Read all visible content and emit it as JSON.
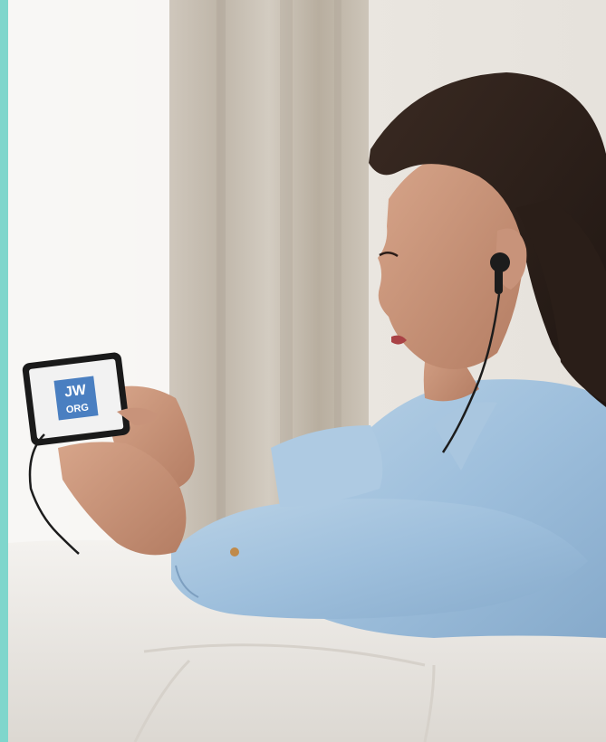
{
  "image": {
    "accent_color": "#7fd6cc",
    "subject": "woman-with-earphones-watching-phone",
    "device_screen": {
      "logo_line1": "JW",
      "logo_line2": "ORG",
      "logo_color": "#4a7fc1"
    }
  }
}
